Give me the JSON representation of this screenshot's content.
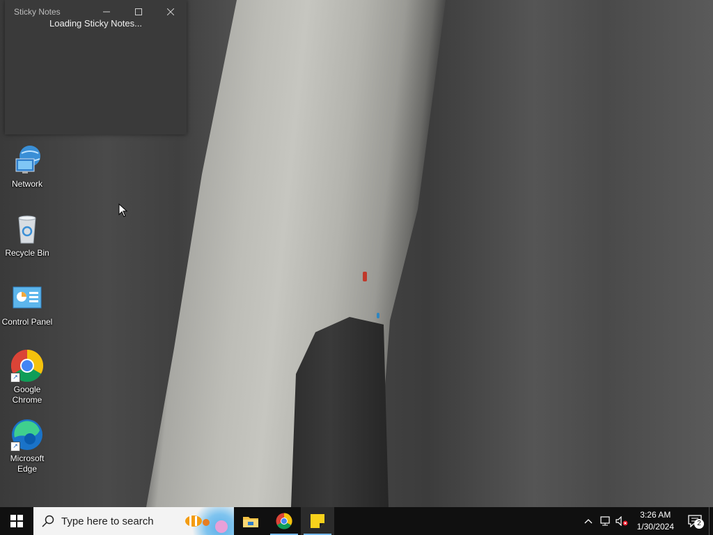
{
  "sticky_notes": {
    "title": "Sticky Notes",
    "loading_text": "Loading Sticky Notes..."
  },
  "desktop_icons": [
    {
      "label": "Network"
    },
    {
      "label": "Recycle Bin"
    },
    {
      "label": "Control Panel"
    },
    {
      "label": "Google Chrome"
    },
    {
      "label": "Microsoft Edge"
    }
  ],
  "taskbar": {
    "search_placeholder": "Type here to search",
    "apps": [
      "File Explorer",
      "Google Chrome",
      "Sticky Notes"
    ],
    "clock_time": "3:26 AM",
    "clock_date": "1/30/2024",
    "notification_count": "2"
  },
  "colors": {
    "taskbar_bg": "#101010",
    "window_bg": "#3a3a3a",
    "active_underline": "#76b9ed"
  }
}
